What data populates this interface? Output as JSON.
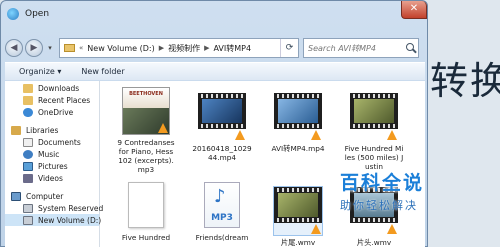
{
  "background": {
    "text": "转换"
  },
  "window": {
    "title": "Open",
    "close_label": "✕"
  },
  "address": {
    "crumbs": [
      "New Volume (D:)",
      "视频制作",
      "AVI转MP4"
    ],
    "search_placeholder": "Search AVI转MP4"
  },
  "toolbar": {
    "organize": "Organize ▾",
    "new_folder": "New folder"
  },
  "nav": {
    "favorites": [
      {
        "label": "Downloads",
        "icon": "folder"
      },
      {
        "label": "Recent Places",
        "icon": "folder"
      },
      {
        "label": "OneDrive",
        "icon": "cloud"
      }
    ],
    "libraries_label": "Libraries",
    "libraries": [
      {
        "label": "Documents",
        "icon": "doc"
      },
      {
        "label": "Music",
        "icon": "music"
      },
      {
        "label": "Pictures",
        "icon": "pic"
      },
      {
        "label": "Videos",
        "icon": "vid"
      }
    ],
    "computer_label": "Computer",
    "drives": [
      {
        "label": "System Reserved",
        "icon": "drive"
      },
      {
        "label": "New Volume (D:)",
        "icon": "drive"
      }
    ]
  },
  "files": [
    {
      "name": "9 Contredanses for Piano, Hess 102 (excerpts).mp3",
      "album_title": "BEETHOVEN"
    },
    {
      "name": "20160418_102944.mp4"
    },
    {
      "name": "AVI转MP4.mp4"
    },
    {
      "name": "Five Hundred Miles (500 miles) Justin"
    },
    {
      "name": "Five Hundred"
    },
    {
      "name": "Friends(dream",
      "mp3_label": "MP3"
    },
    {
      "name": "片尾.wmv"
    },
    {
      "name": "片头.wmv"
    }
  ],
  "watermark": {
    "logo": "百科全说",
    "sub": "助你轻松解决"
  }
}
